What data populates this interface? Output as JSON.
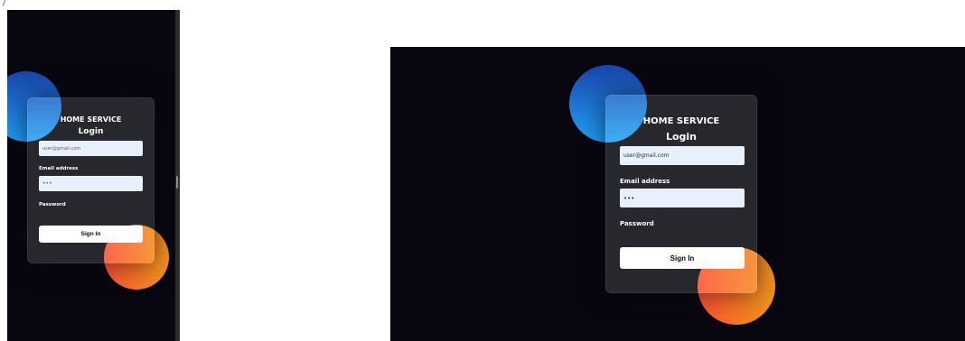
{
  "corner_mark": "/",
  "colors": {
    "page_background": "#080710",
    "orb_blue_start": "#1845ad",
    "orb_blue_end": "#23a2f6",
    "orb_orange_start": "#ff512f",
    "orb_orange_end": "#f09819",
    "input_background": "#e8f0fe",
    "button_background": "#ffffff"
  },
  "icons": [
    "split-view-handle-icon"
  ],
  "login_small": {
    "brand": "HOME SERVICE",
    "heading": "Login",
    "email_value": "user@gmail.com",
    "email_label": "Email address",
    "password_value": "•••",
    "password_label": "Password",
    "sign_in_label": "Sign In"
  },
  "login_large": {
    "brand": "HOME SERVICE",
    "heading": "Login",
    "email_value": "user@gmail.com",
    "email_label": "Email address",
    "password_value": "•••",
    "password_label": "Password",
    "sign_in_label": "Sign In"
  }
}
